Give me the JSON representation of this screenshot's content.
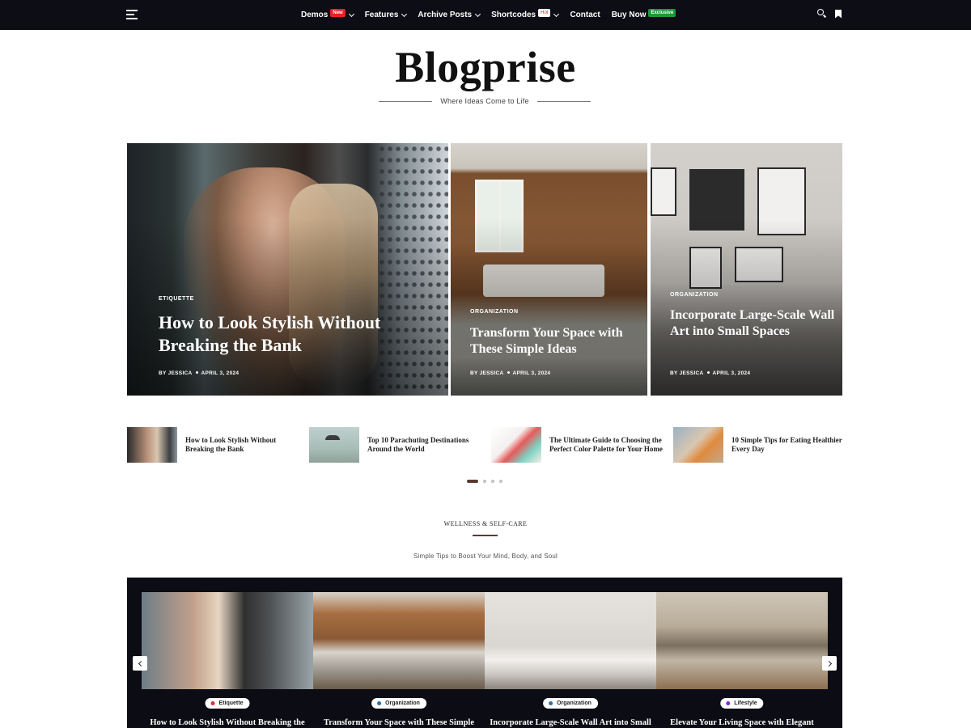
{
  "nav": {
    "items": [
      {
        "label": "Demos",
        "badge": "New",
        "badge_kind": "new",
        "has_dropdown": true
      },
      {
        "label": "Features",
        "badge": "",
        "badge_kind": "",
        "has_dropdown": true
      },
      {
        "label": "Archive Posts",
        "badge": "",
        "badge_kind": "",
        "has_dropdown": true
      },
      {
        "label": "Shortcodes",
        "badge": "Hot",
        "badge_kind": "hot",
        "has_dropdown": true
      },
      {
        "label": "Contact",
        "badge": "",
        "badge_kind": "",
        "has_dropdown": false
      },
      {
        "label": "Buy Now",
        "badge": "Exclusive",
        "badge_kind": "exclusive",
        "has_dropdown": false
      }
    ],
    "icons": [
      "menu-icon",
      "search-icon",
      "bookmark-icon"
    ]
  },
  "site": {
    "logo": "Blogprise",
    "tagline": "Where Ideas Come to Life"
  },
  "hero": [
    {
      "category": "ETIQUETTE",
      "title": "How to Look Stylish Without Breaking the Bank",
      "by": "BY",
      "author": "JESSICA",
      "date": "APRIL 3, 2024"
    },
    {
      "category": "ORGANIZATION",
      "title": "Transform Your Space with These Simple Ideas",
      "by": "BY",
      "author": "JESSICA",
      "date": "APRIL 3, 2024"
    },
    {
      "category": "ORGANIZATION",
      "title": "Incorporate Large-Scale Wall Art into Small Spaces",
      "by": "BY",
      "author": "JESSICA",
      "date": "APRIL 3, 2024"
    }
  ],
  "thumbs": [
    {
      "title": "How to Look Stylish Without Breaking the Bank"
    },
    {
      "title": "Top 10 Parachuting Destinations Around the World"
    },
    {
      "title": "The Ultimate Guide to Choosing the Perfect Color Palette for Your Home"
    },
    {
      "title": "10 Simple Tips for Eating Healthier Every Day"
    }
  ],
  "slider_dots": {
    "count": 4,
    "active": 1
  },
  "section": {
    "title": "WELLNESS & SELF-CARE",
    "subtitle": "Simple Tips to Boost Your Mind, Body, and Soul"
  },
  "carousel": {
    "cards": [
      {
        "category": "Etiquette",
        "dot_color": "#d8323a",
        "title": "How to Look Stylish Without Breaking the"
      },
      {
        "category": "Organization",
        "dot_color": "#2a6fa8",
        "title": "Transform Your Space with These Simple"
      },
      {
        "category": "Organization",
        "dot_color": "#2a6fa8",
        "title": "Incorporate Large-Scale Wall Art into Small"
      },
      {
        "category": "Lifestyle",
        "dot_color": "#7b2fd0",
        "title": "Elevate Your Living Space with Elegant"
      }
    ]
  },
  "colors": {
    "nav_bg": "#0d0d15",
    "accent": "#5a3a34",
    "badge_new": "#e8202a",
    "badge_exclusive": "#1a9a3a",
    "carousel_bg": "#0c0c14"
  }
}
